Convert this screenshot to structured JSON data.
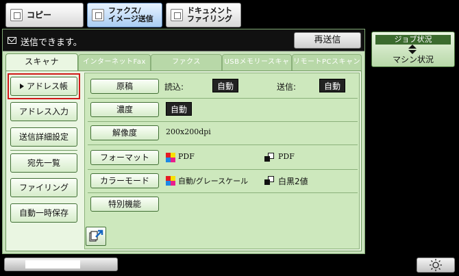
{
  "modes": [
    {
      "label": "コピー",
      "icon": "copy-icon"
    },
    {
      "label": "ファクス/\nイメージ送信",
      "icon": "fax-image-send-icon"
    },
    {
      "label": "ドキュメント\nファイリング",
      "icon": "document-filing-icon"
    }
  ],
  "status": {
    "text": "送信できます。",
    "resend_label": "再送信"
  },
  "tabs": [
    "スキャナ",
    "インターネットFax",
    "ファクス",
    "USBメモリースキャン",
    "リモートPCスキャン"
  ],
  "sidebar": [
    "アドレス帳",
    "アドレス入力",
    "送信詳細設定",
    "宛先一覧",
    "ファイリング",
    "自動一時保存"
  ],
  "settings": {
    "original": {
      "label": "原稿",
      "read_label": "読込:",
      "read_value": "自動",
      "send_label": "送信:",
      "send_value": "自動"
    },
    "density": {
      "label": "濃度",
      "value": "自動"
    },
    "resolution": {
      "label": "解像度",
      "value": "200x200dpi"
    },
    "format": {
      "label": "フォーマット",
      "color_value": "PDF",
      "mono_value": "PDF"
    },
    "color_mode": {
      "label": "カラーモード",
      "color_value": "自動/グレースケール",
      "mono_value": "白黒2値"
    },
    "special": {
      "label": "特別機能"
    }
  },
  "job_status": {
    "top": "ジョブ状況",
    "bottom": "マシン状況"
  },
  "colors": {
    "accent_green": "#3b6b2e",
    "highlight_red": "#d01818",
    "active_mode_blue": "#a9cdf2"
  }
}
